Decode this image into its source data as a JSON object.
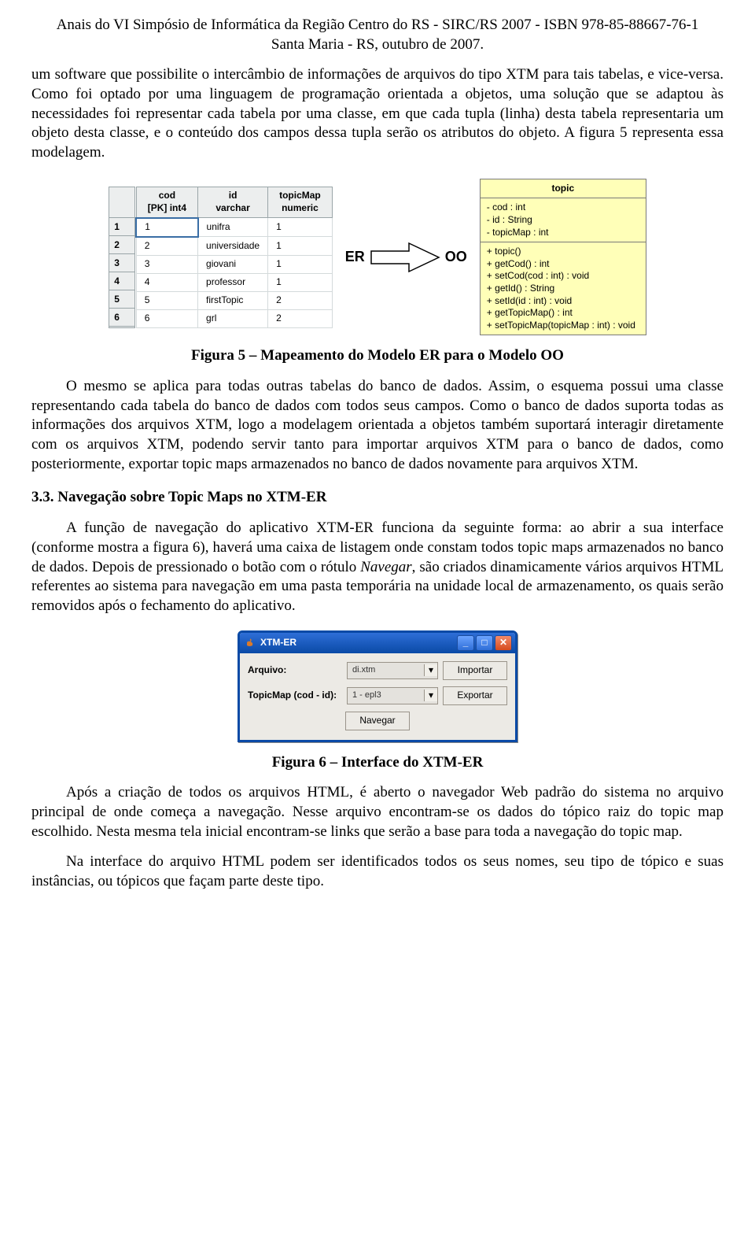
{
  "header": {
    "line1": "Anais do VI Simpósio de Informática da Região Centro do RS - SIRC/RS 2007 - ISBN 978-85-88667-76-1",
    "line2": "Santa Maria - RS, outubro de 2007."
  },
  "body": {
    "p1": "um software que possibilite o intercâmbio de informações de arquivos do tipo XTM para tais tabelas, e vice-versa. Como foi optado por uma linguagem de programação orientada a objetos, uma solução que se adaptou às necessidades foi representar cada tabela por uma classe, em que cada tupla (linha) desta tabela representaria um objeto desta classe, e o conteúdo dos campos dessa tupla serão os atributos do objeto. A figura 5 representa essa modelagem.",
    "fig5_caption": "Figura 5 – Mapeamento do Modelo ER para o Modelo OO",
    "p2": "O mesmo se aplica para todas outras tabelas do banco de dados. Assim, o esquema possui uma classe representando cada tabela do banco de dados com todos seus campos. Como o banco de dados suporta todas as informações dos arquivos XTM, logo a modelagem orientada a objetos também suportará interagir diretamente com os arquivos XTM, podendo servir tanto para importar arquivos XTM para o banco de dados, como posteriormente, exportar topic maps armazenados no banco de dados novamente para arquivos XTM.",
    "sec33_title": "3.3. Navegação sobre Topic Maps no XTM-ER",
    "p3a": "A função de navegação do aplicativo XTM-ER funciona da seguinte forma: ao abrir a sua interface (conforme mostra a figura 6), haverá uma caixa de listagem onde constam todos topic maps armazenados no banco de dados. Depois de pressionado o botão com o rótulo ",
    "p3b_italic": "Navegar",
    "p3c": ", são criados dinamicamente vários arquivos HTML referentes ao sistema para navegação em uma pasta temporária na unidade local de armazenamento, os quais serão removidos após o fechamento do aplicativo.",
    "fig6_caption": "Figura 6 – Interface do XTM-ER",
    "p4": "Após a criação de todos os arquivos HTML, é aberto o navegador Web padrão do sistema no arquivo principal de onde começa a navegação. Nesse arquivo encontram-se os dados do tópico raiz do topic map escolhido. Nesta mesma tela inicial encontram-se links que serão a base para toda a navegação do topic map.",
    "p5": "Na interface do arquivo HTML podem ser identificados todos os seus nomes, seu tipo de tópico e suas instâncias, ou tópicos que façam parte deste tipo."
  },
  "fig5": {
    "er_label": "ER",
    "oo_label": "OO",
    "table": {
      "headers": [
        "cod\n[PK] int4",
        "id\nvarchar",
        "topicMap\nnumeric"
      ],
      "rows": [
        {
          "n": "1",
          "cod": "1",
          "id": "unifra",
          "tm": "1"
        },
        {
          "n": "2",
          "cod": "2",
          "id": "universidade",
          "tm": "1"
        },
        {
          "n": "3",
          "cod": "3",
          "id": "giovani",
          "tm": "1"
        },
        {
          "n": "4",
          "cod": "4",
          "id": "professor",
          "tm": "1"
        },
        {
          "n": "5",
          "cod": "5",
          "id": "firstTopic",
          "tm": "2"
        },
        {
          "n": "6",
          "cod": "6",
          "id": "grl",
          "tm": "2"
        }
      ]
    },
    "uml": {
      "title": "topic",
      "attrs": [
        "- cod : int",
        "- id : String",
        "- topicMap : int"
      ],
      "ops": [
        "+ topic()",
        "+ getCod() : int",
        "+ setCod(cod : int) : void",
        "+ getId() : String",
        "+ setId(id : int) : void",
        "+ getTopicMap() : int",
        "+ setTopicMap(topicMap : int) : void"
      ]
    }
  },
  "fig6": {
    "title": "XTM-ER",
    "rows": {
      "arquivo_label": "Arquivo:",
      "arquivo_value": "di.xtm",
      "topicmap_label": "TopicMap (cod - id):",
      "topicmap_value": "1 - epl3"
    },
    "buttons": {
      "importar": "Importar",
      "exportar": "Exportar",
      "navegar": "Navegar"
    }
  }
}
